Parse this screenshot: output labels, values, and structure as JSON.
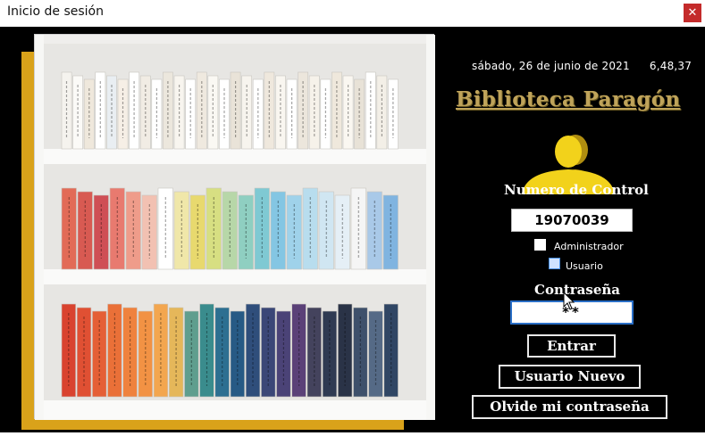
{
  "window": {
    "title": "Inicio de sesión",
    "close_glyph": "✕"
  },
  "datetime": {
    "date": "sábado, 26 de junio de 2021",
    "time": "6,48,37"
  },
  "brand": {
    "name": "Biblioteca Paragón",
    "color": "#bfa35a"
  },
  "avatar": {
    "icon": "user-silhouette-icon",
    "color": "#f2d21b"
  },
  "form": {
    "control_label": "Numero de Control",
    "control_value": "19070039",
    "roles": [
      {
        "label": "Administrador",
        "checked": false
      },
      {
        "label": "Usuario",
        "checked": false
      }
    ],
    "password_label": "Contraseña",
    "password_value": "**"
  },
  "buttons": {
    "login": "Entrar",
    "new_user": "Usuario Nuevo",
    "forgot": "Olvide mi contraseña"
  },
  "decor": {
    "accent_gold": "#d9a21a",
    "close_red": "#c42b2b"
  }
}
